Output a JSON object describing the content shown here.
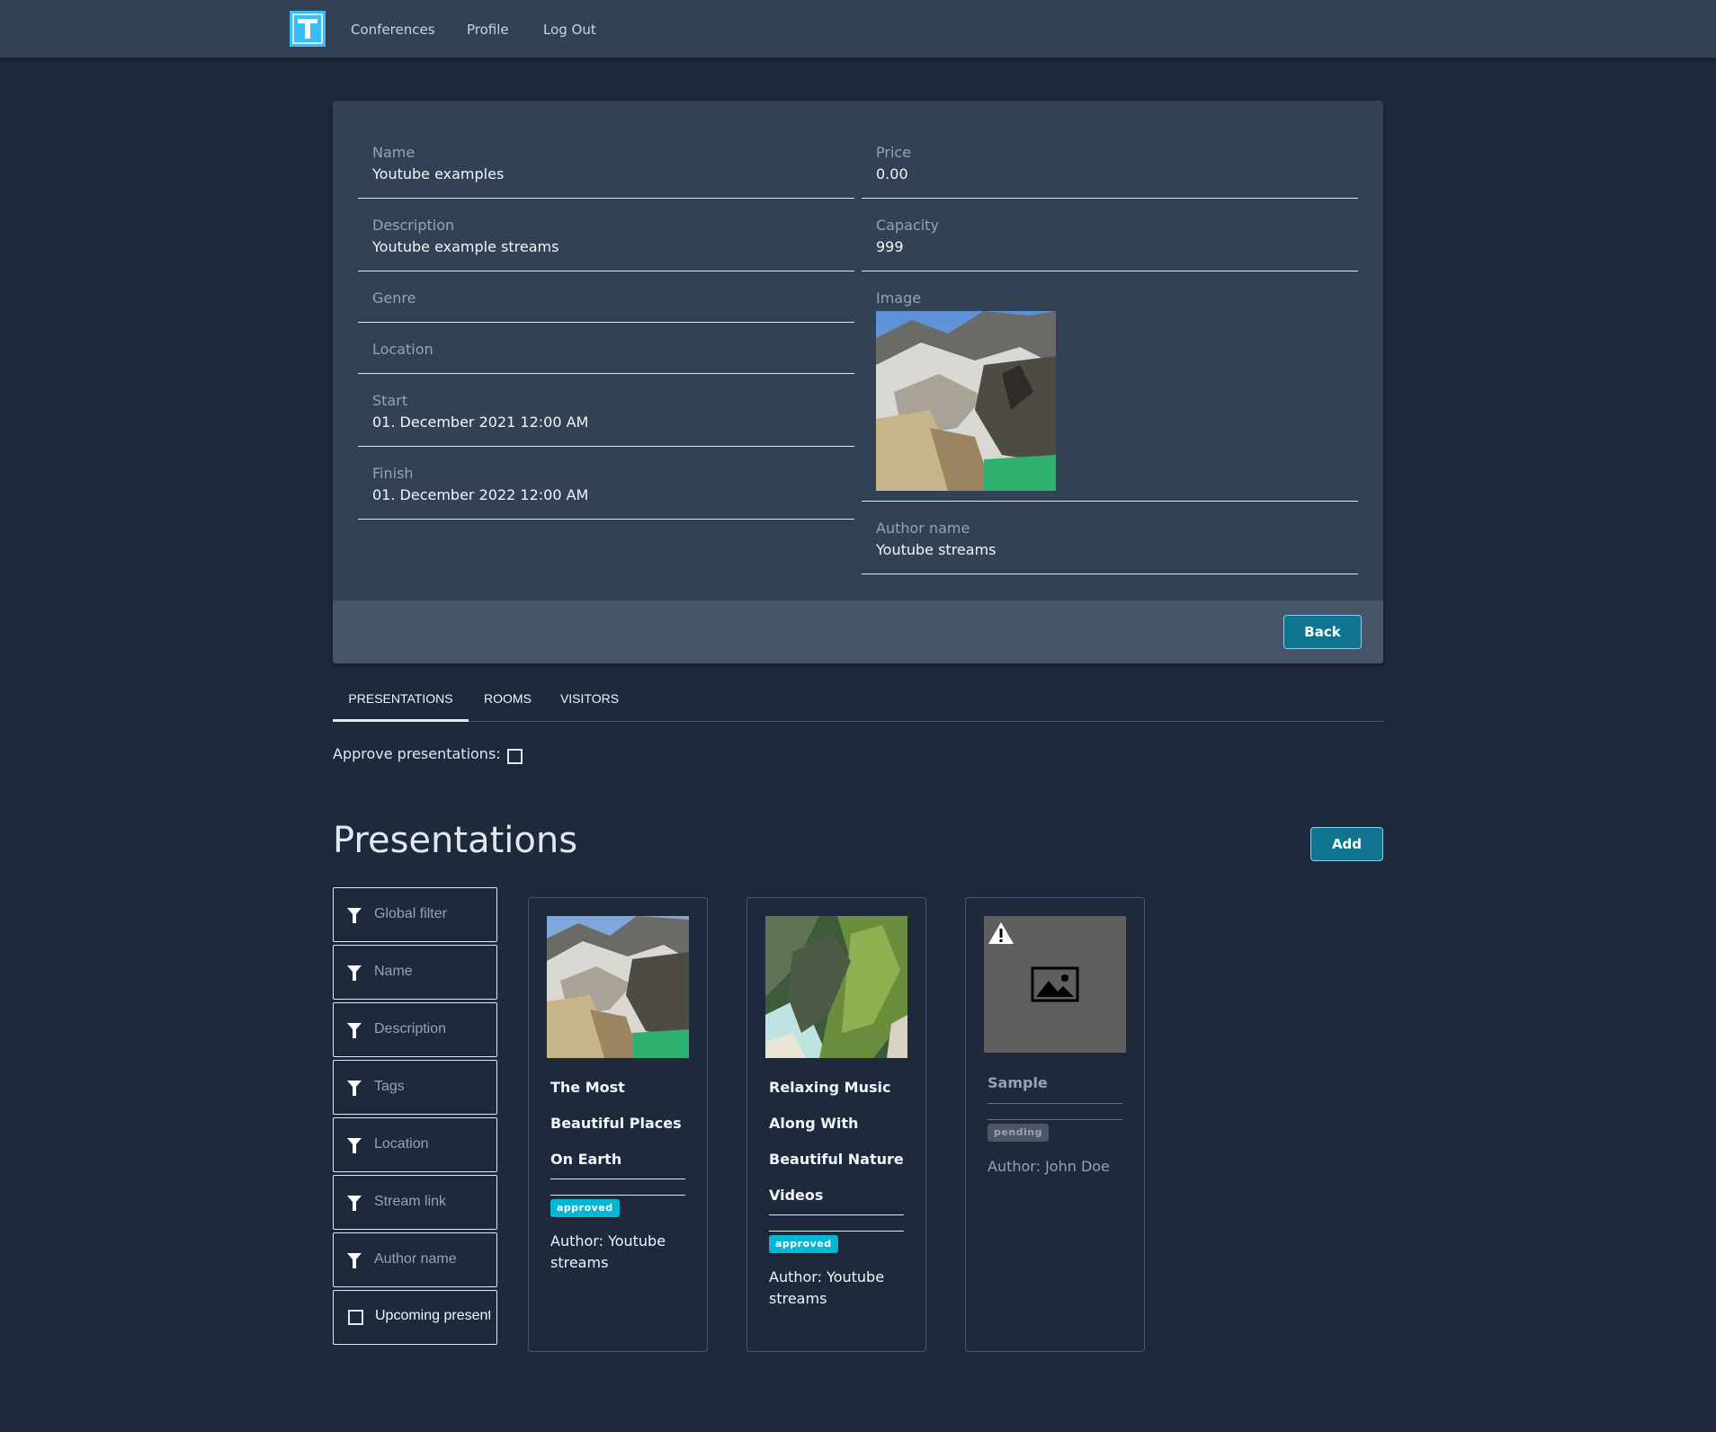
{
  "nav": {
    "logo_letter": "T",
    "links": [
      "Conferences",
      "Profile",
      "Log Out"
    ]
  },
  "details": {
    "name": {
      "label": "Name",
      "value": "Youtube examples"
    },
    "description": {
      "label": "Description",
      "value": "Youtube example streams"
    },
    "genre": {
      "label": "Genre",
      "value": ""
    },
    "location": {
      "label": "Location",
      "value": ""
    },
    "start": {
      "label": "Start",
      "value": "01. December 2021 12:00 AM"
    },
    "finish": {
      "label": "Finish",
      "value": "01. December 2022 12:00 AM"
    },
    "price": {
      "label": "Price",
      "value": "0.00"
    },
    "capacity": {
      "label": "Capacity",
      "value": "999"
    },
    "image": {
      "label": "Image"
    },
    "author": {
      "label": "Author name",
      "value": "Youtube streams"
    },
    "back_label": "Back"
  },
  "tabs": [
    "PRESENTATIONS",
    "ROOMS",
    "VISITORS"
  ],
  "approve_label": "Approve presentations:",
  "approve_checked": false,
  "presentations": {
    "title": "Presentations",
    "add_label": "Add",
    "filters": {
      "global": "Global filter",
      "name": "Name",
      "description": "Description",
      "tags": "Tags",
      "location": "Location",
      "stream": "Stream link",
      "author": "Author name",
      "upcoming": "Upcoming presentations"
    },
    "cards": [
      {
        "title": "The Most Beautiful Places On Earth",
        "status": "approved",
        "author": "Author: Youtube streams"
      },
      {
        "title": "Relaxing Music Along With Beautiful Nature Videos",
        "status": "approved",
        "author": "Author: Youtube streams"
      },
      {
        "title": "Sample",
        "status": "pending",
        "author": "Author: John Doe"
      }
    ]
  },
  "colors": {
    "background": "#1e293b",
    "panel": "#334155",
    "accent": "#0e7490",
    "logo": "#38bdf8",
    "approved_badge": "#06b6d4",
    "pending_badge": "#4b5563"
  }
}
